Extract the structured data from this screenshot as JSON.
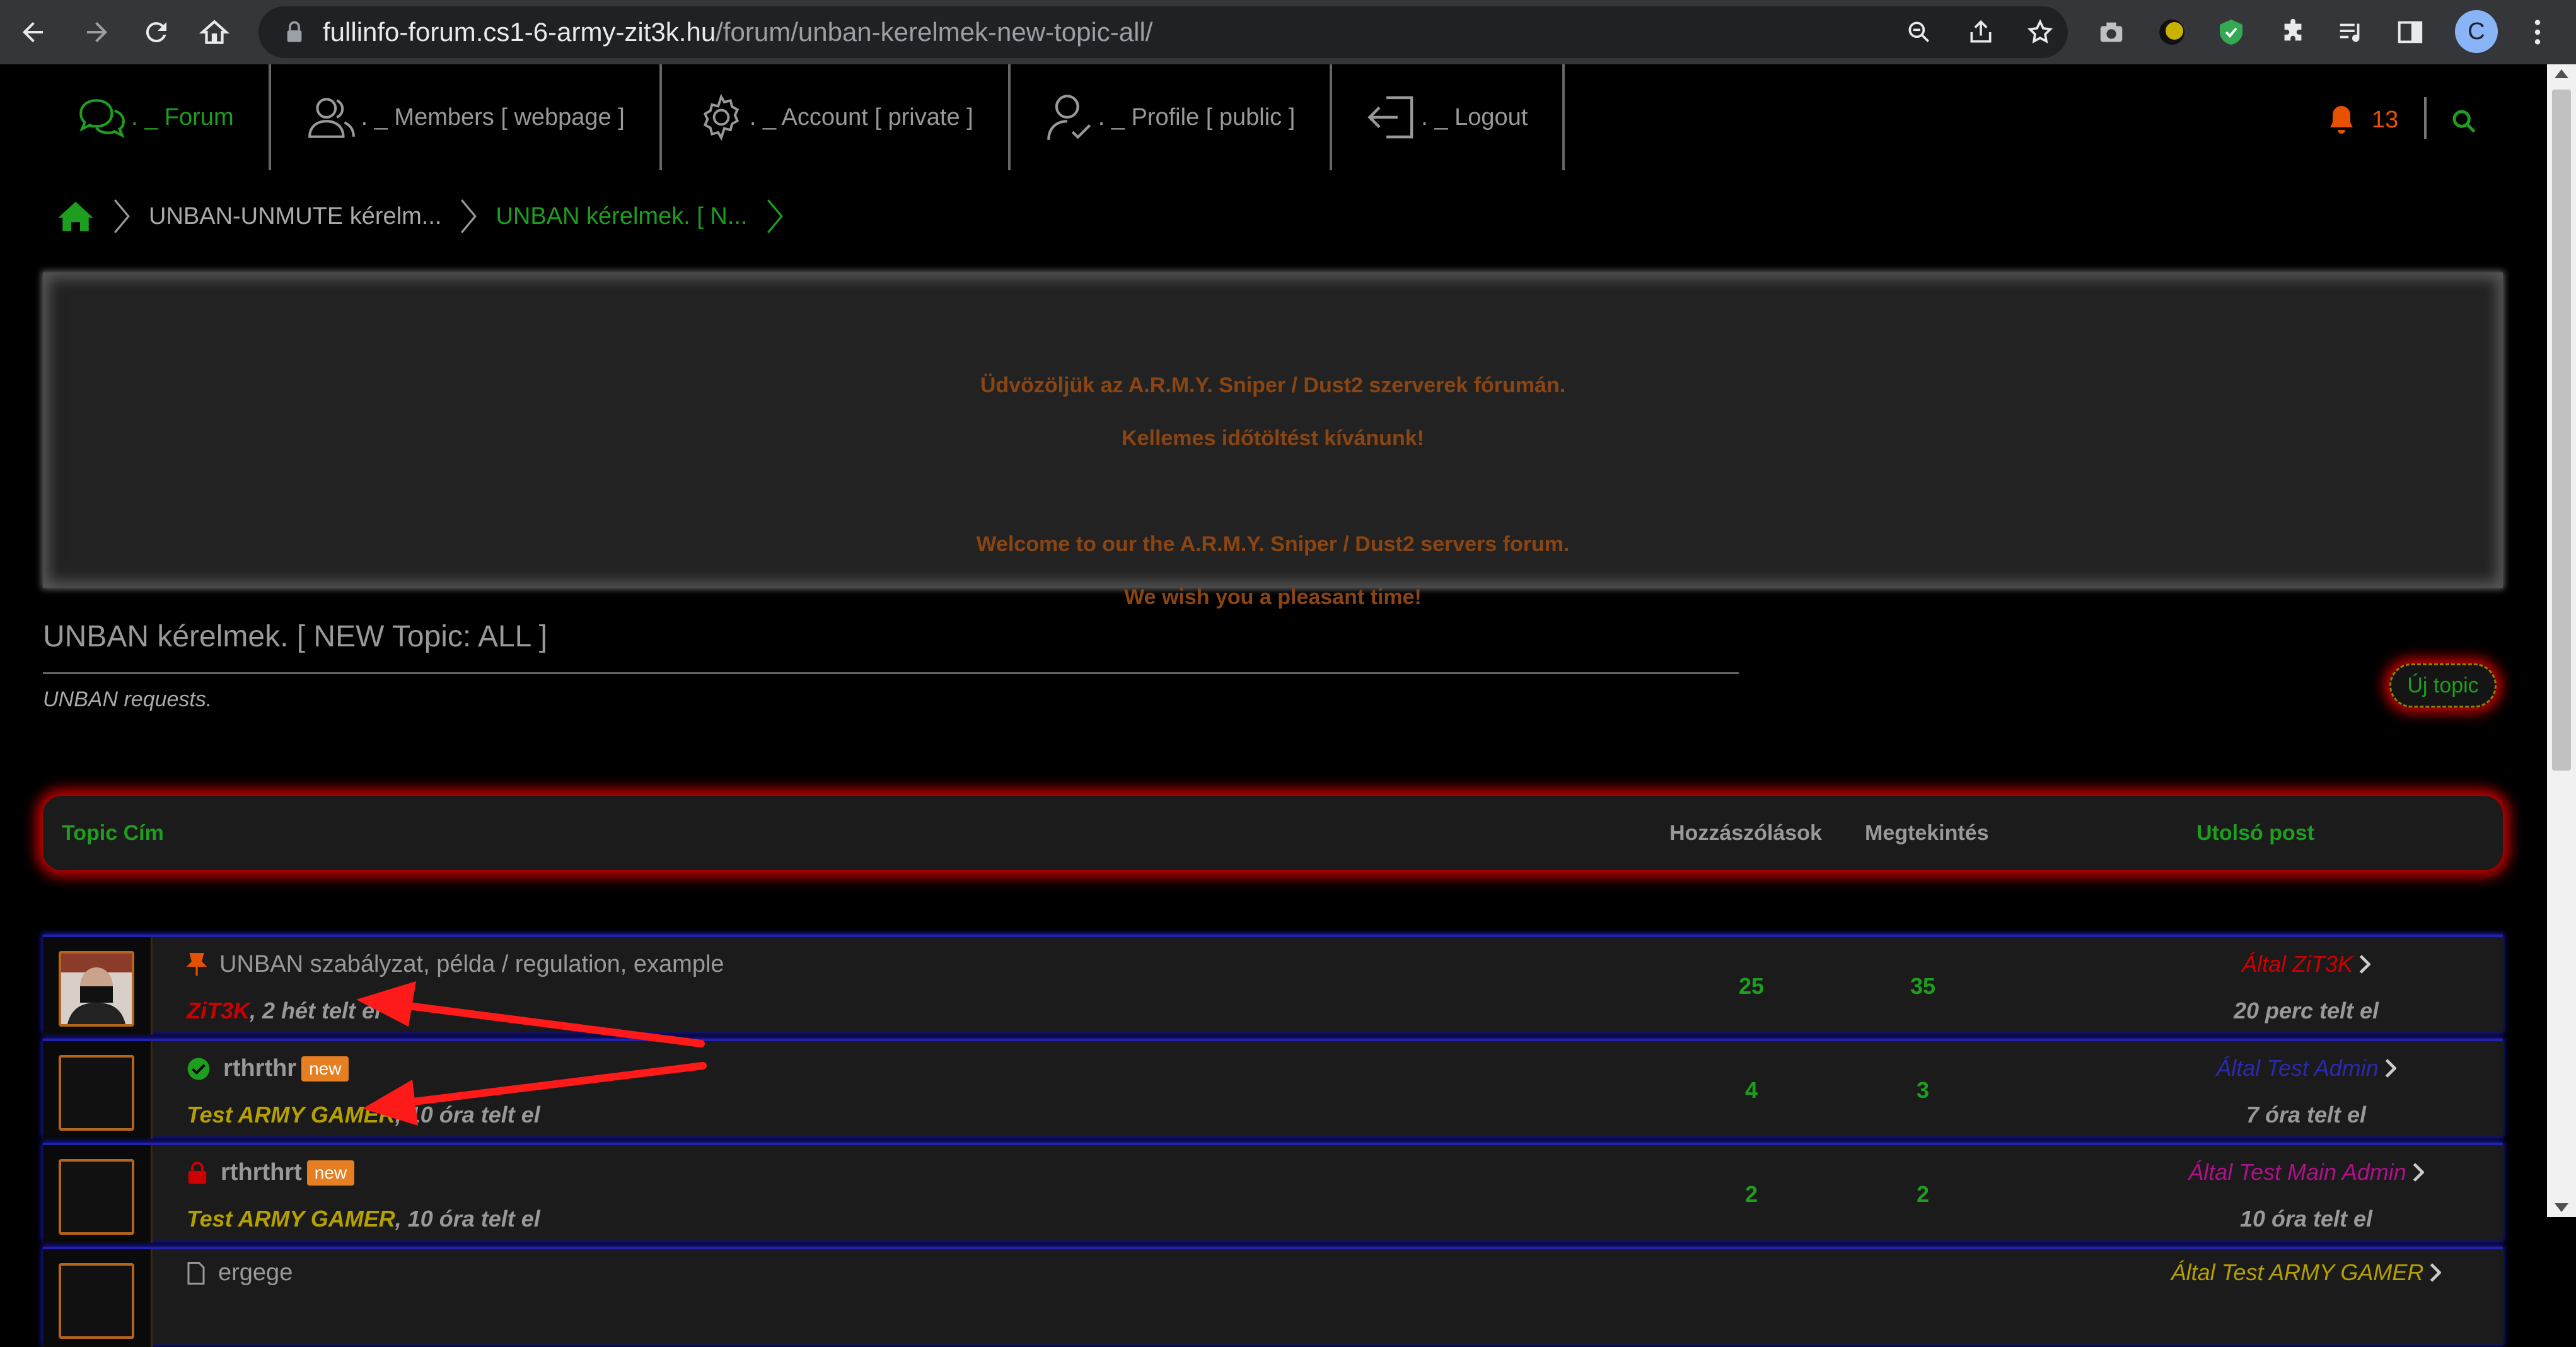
{
  "browser": {
    "url_host": "fullinfo-forum.cs1-6-army-zit3k.hu",
    "url_path": "/forum/unban-kerelmek-new-topic-all/",
    "profile_initial": "C"
  },
  "nav": {
    "items": [
      {
        "label": ". _ Forum"
      },
      {
        "label": ". _ Members [ webpage ]"
      },
      {
        "label": ". _ Account [ private ]"
      },
      {
        "label": ". _ Profile [ public ]"
      },
      {
        "label": ". _ Logout"
      }
    ],
    "notification_count": "13"
  },
  "breadcrumb": {
    "parent": "UNBAN-UNMUTE kérelm...",
    "current": "UNBAN kérelmek. [ N..."
  },
  "welcome": {
    "line1": "Üdvözöljük az A.R.M.Y. Sniper / Dust2 szerverek fórumán.",
    "line2": "Kellemes időtöltést kívánunk!",
    "line3": "Welcome to our the A.R.M.Y. Sniper / Dust2 servers forum.",
    "line4": "We wish you a pleasant time!"
  },
  "forum": {
    "title": "UNBAN kérelmek. [ NEW Topic: ALL ]",
    "subtitle": "UNBAN requests.",
    "new_topic_button": "Új topic"
  },
  "table": {
    "headers": {
      "topic": "Topic Cím",
      "replies": "Hozzászólások",
      "views": "Megtekintés",
      "last_post": "Utolsó post"
    },
    "rows": [
      {
        "icon": "pin-icon",
        "title": "UNBAN szabályzat, példa / regulation, example",
        "badge": "",
        "author": "ZiT3K",
        "author_color": "#cc0000",
        "ago": ", 2 hét telt el",
        "replies": "25",
        "views": "35",
        "last_by": "Által ZiT3K",
        "last_by_color": "#cc0000",
        "last_time": "20 perc telt el"
      },
      {
        "icon": "check-circle-icon",
        "title": "rthrthr",
        "badge": "new",
        "author": "Test ARMY GAMER",
        "author_color": "#b5a000",
        "ago": ", 10 óra telt el",
        "replies": "4",
        "views": "3",
        "last_by": "Által Test Admin",
        "last_by_color": "#2a2ab0",
        "last_time": "7 óra telt el"
      },
      {
        "icon": "lock-icon",
        "title": "rthrthrt",
        "badge": "new",
        "author": "Test ARMY GAMER",
        "author_color": "#b5a000",
        "ago": ", 10 óra telt el",
        "replies": "2",
        "views": "2",
        "last_by": "Által Test Main Admin",
        "last_by_color": "#b0108a",
        "last_time": "10 óra telt el"
      },
      {
        "icon": "document-icon",
        "title": "ergege",
        "badge": "",
        "author": "",
        "author_color": "#b5a000",
        "ago": "",
        "replies": "",
        "views": "",
        "last_by": "Által Test ARMY GAMER",
        "last_by_color": "#b5a000",
        "last_time": ""
      }
    ]
  },
  "colors": {
    "accent_green": "#1e9e1e",
    "welcome_text": "#8b4513",
    "header_glow": "#cc0000",
    "row_glow": "#1a1ab0",
    "annotation_arrow": "#ff1a1a"
  }
}
